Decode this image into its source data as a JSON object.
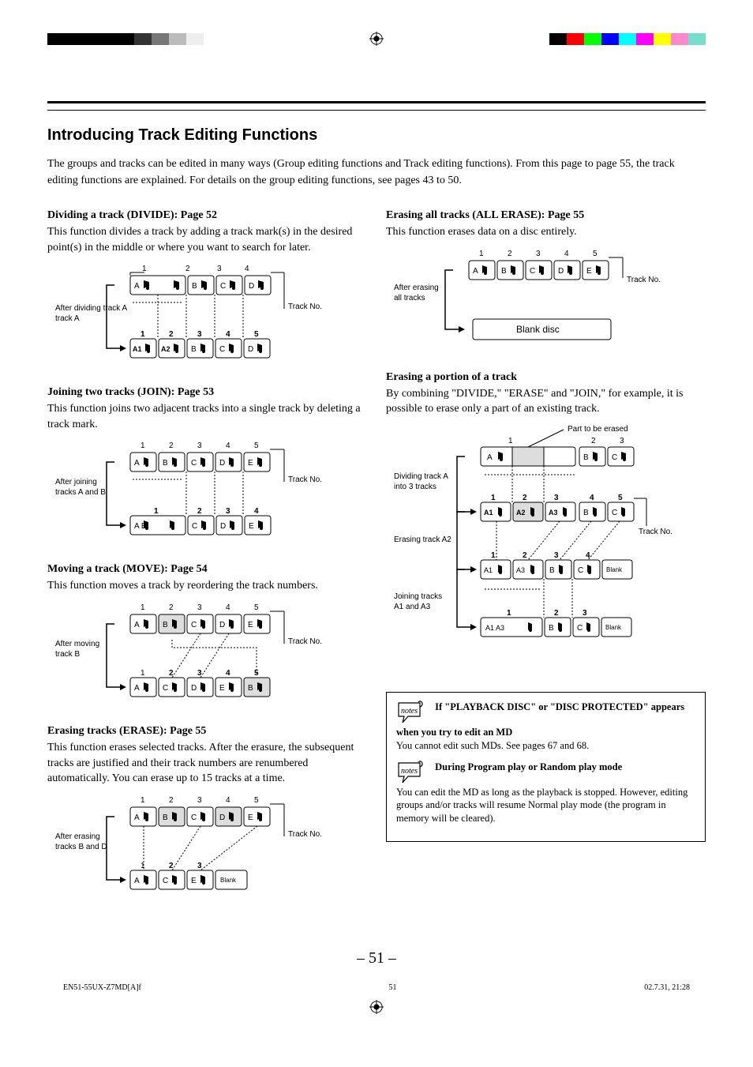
{
  "heading": "Introducing Track Editing Functions",
  "intro": "The groups and tracks can be edited in many ways (Group editing functions and Track editing functions). From this page to page 55, the track editing functions are explained. For details on the group editing functions, see pages 43 to 50.",
  "divide": {
    "title": "Dividing a track (DIVIDE): Page 52",
    "body": "This function divides a track by adding a track mark(s) in the desired point(s) in the middle or where you want to search for later.",
    "caption": "After dividing track A",
    "trackno": "Track No.",
    "top_nums": [
      "1",
      "2",
      "3",
      "4"
    ],
    "top_labels": [
      "A",
      "",
      "B",
      "C",
      "D"
    ],
    "bot_nums": [
      "1",
      "2",
      "3",
      "4",
      "5"
    ],
    "bot_labels": [
      "A1",
      "A2",
      "B",
      "C",
      "D"
    ]
  },
  "join": {
    "title": "Joining two tracks (JOIN): Page 53",
    "body": "This function joins two adjacent tracks into a single track by deleting a track mark.",
    "caption": "After joining tracks A and B",
    "trackno": "Track No.",
    "top_nums": [
      "1",
      "2",
      "3",
      "4",
      "5"
    ],
    "top_labels": [
      "A",
      "B",
      "C",
      "D",
      "E"
    ],
    "bot_nums": [
      "1",
      "2",
      "3",
      "4"
    ],
    "bot_labels": [
      "A  B",
      "C",
      "D",
      "E"
    ]
  },
  "move": {
    "title": "Moving a track (MOVE): Page 54",
    "body": "This function moves a track by reordering the track numbers.",
    "caption": "After moving track B",
    "trackno": "Track No.",
    "top_nums": [
      "1",
      "2",
      "3",
      "4",
      "5"
    ],
    "top_labels": [
      "A",
      "B",
      "C",
      "D",
      "E"
    ],
    "bot_nums": [
      "1",
      "2",
      "3",
      "4",
      "5"
    ],
    "bot_labels": [
      "A",
      "C",
      "D",
      "E",
      "B"
    ]
  },
  "erase": {
    "title": "Erasing tracks (ERASE): Page 55",
    "body": "This function erases selected tracks. After the erasure, the subsequent tracks are justified and their track numbers are renumbered automatically. You can erase up to 15 tracks at a time.",
    "caption": "After erasing tracks B and D",
    "trackno": "Track No.",
    "top_nums": [
      "1",
      "2",
      "3",
      "4",
      "5"
    ],
    "top_labels": [
      "A",
      "B",
      "C",
      "D",
      "E"
    ],
    "bot_nums": [
      "1",
      "2",
      "3"
    ],
    "bot_labels": [
      "A",
      "C",
      "E",
      "Blank"
    ]
  },
  "allerase": {
    "title": "Erasing all tracks (ALL ERASE): Page 55",
    "body": "This function erases data on a disc entirely.",
    "caption": "After erasing all tracks",
    "trackno": "Track No.",
    "top_nums": [
      "1",
      "2",
      "3",
      "4",
      "5"
    ],
    "top_labels": [
      "A",
      "B",
      "C",
      "D",
      "E"
    ],
    "blank_disc": "Blank disc"
  },
  "portion": {
    "title": "Erasing a portion of a track",
    "body": "By combining \"DIVIDE,\" \"ERASE\" and \"JOIN,\" for example, it is possible to erase only a part of an existing track.",
    "part_label": "Part to be erased",
    "trackno": "Track No.",
    "step1_caption": "Dividing track A into 3 tracks",
    "step1_top_nums": [
      "1",
      "2",
      "3"
    ],
    "step1_top_labels": [
      "A",
      "B",
      "C"
    ],
    "step1_bot_nums": [
      "1",
      "2",
      "3",
      "4",
      "5"
    ],
    "step1_bot_labels": [
      "A1",
      "A2",
      "A3",
      "B",
      "C"
    ],
    "step2_caption": "Erasing track A2",
    "step2_nums": [
      "1",
      "2",
      "3",
      "4"
    ],
    "step2_labels": [
      "A1",
      "A3",
      "B",
      "C",
      "Blank"
    ],
    "step3_caption": "Joining tracks A1 and A3",
    "step3_nums": [
      "1",
      "2",
      "3"
    ],
    "step3_labels": [
      "A1  A3",
      "B",
      "C",
      "Blank"
    ]
  },
  "notes": {
    "n1_title": "If \"PLAYBACK DISC\" or \"DISC PROTECTED\" appears when you try to edit an MD",
    "n1_body": "You cannot edit such MDs. See pages 67 and 68.",
    "n2_title": "During Program play or Random play mode",
    "n2_body": "You can edit the MD as long as the playback is stopped. However, editing groups and/or tracks will resume Normal play mode (the program in memory will be cleared)."
  },
  "page_number": "– 51 –",
  "footer": {
    "left": "EN51-55UX-Z7MD[A]f",
    "center": "51",
    "right": "02.7.31, 21:28"
  }
}
